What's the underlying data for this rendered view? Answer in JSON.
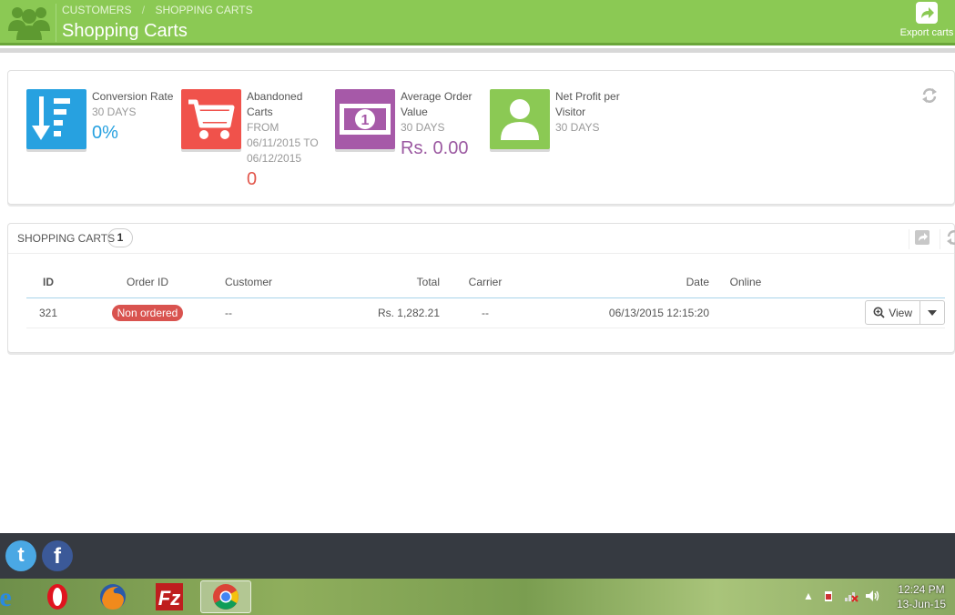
{
  "header": {
    "breadcrumb": [
      "CUSTOMERS",
      "SHOPPING CARTS"
    ],
    "breadcrumb_separator": "/",
    "title": "Shopping Carts",
    "export_label": "Export carts",
    "logo_icon": "customers-icon",
    "accent": "#8bc954"
  },
  "kpis": [
    {
      "label": "Conversion Rate",
      "period": "30 DAYS",
      "value": "0%",
      "icon": "sort-down-icon",
      "color": "#27a1e0",
      "value_color": "#27a1e0"
    },
    {
      "label": "Abandoned Carts",
      "period": "FROM 06/11/2015 TO 06/12/2015",
      "value": "0",
      "icon": "cart-icon",
      "color": "#f0524b",
      "value_color": "#e2574c"
    },
    {
      "label": "Average Order Value",
      "period": "30 DAYS",
      "value": "Rs. 0.00",
      "icon": "money-icon",
      "color": "#a659a8",
      "value_color": "#9b59a1"
    },
    {
      "label": "Net Profit per Visitor",
      "period": "30 DAYS",
      "value": "",
      "icon": "user-icon",
      "color": "#8bc954",
      "value_color": "#8bc954"
    }
  ],
  "carts_panel": {
    "title": "SHOPPING CARTS",
    "count": "1",
    "columns": [
      "ID",
      "Order ID",
      "Customer",
      "Total",
      "Carrier",
      "Date",
      "Online"
    ],
    "rows": [
      {
        "id": "321",
        "order_id": "Non ordered",
        "customer": "--",
        "total": "Rs. 1,282.21",
        "carrier": "--",
        "date": "06/13/2015 12:15:20",
        "online": ""
      }
    ],
    "view_label": "View"
  },
  "social": {
    "twitter_glyph": "t",
    "facebook_glyph": "f"
  },
  "taskbar": {
    "apps": [
      "ie-icon",
      "opera-icon",
      "firefox-icon",
      "filezilla-icon",
      "chrome-icon"
    ],
    "time": "12:24 PM",
    "date": "13-Jun-15"
  }
}
